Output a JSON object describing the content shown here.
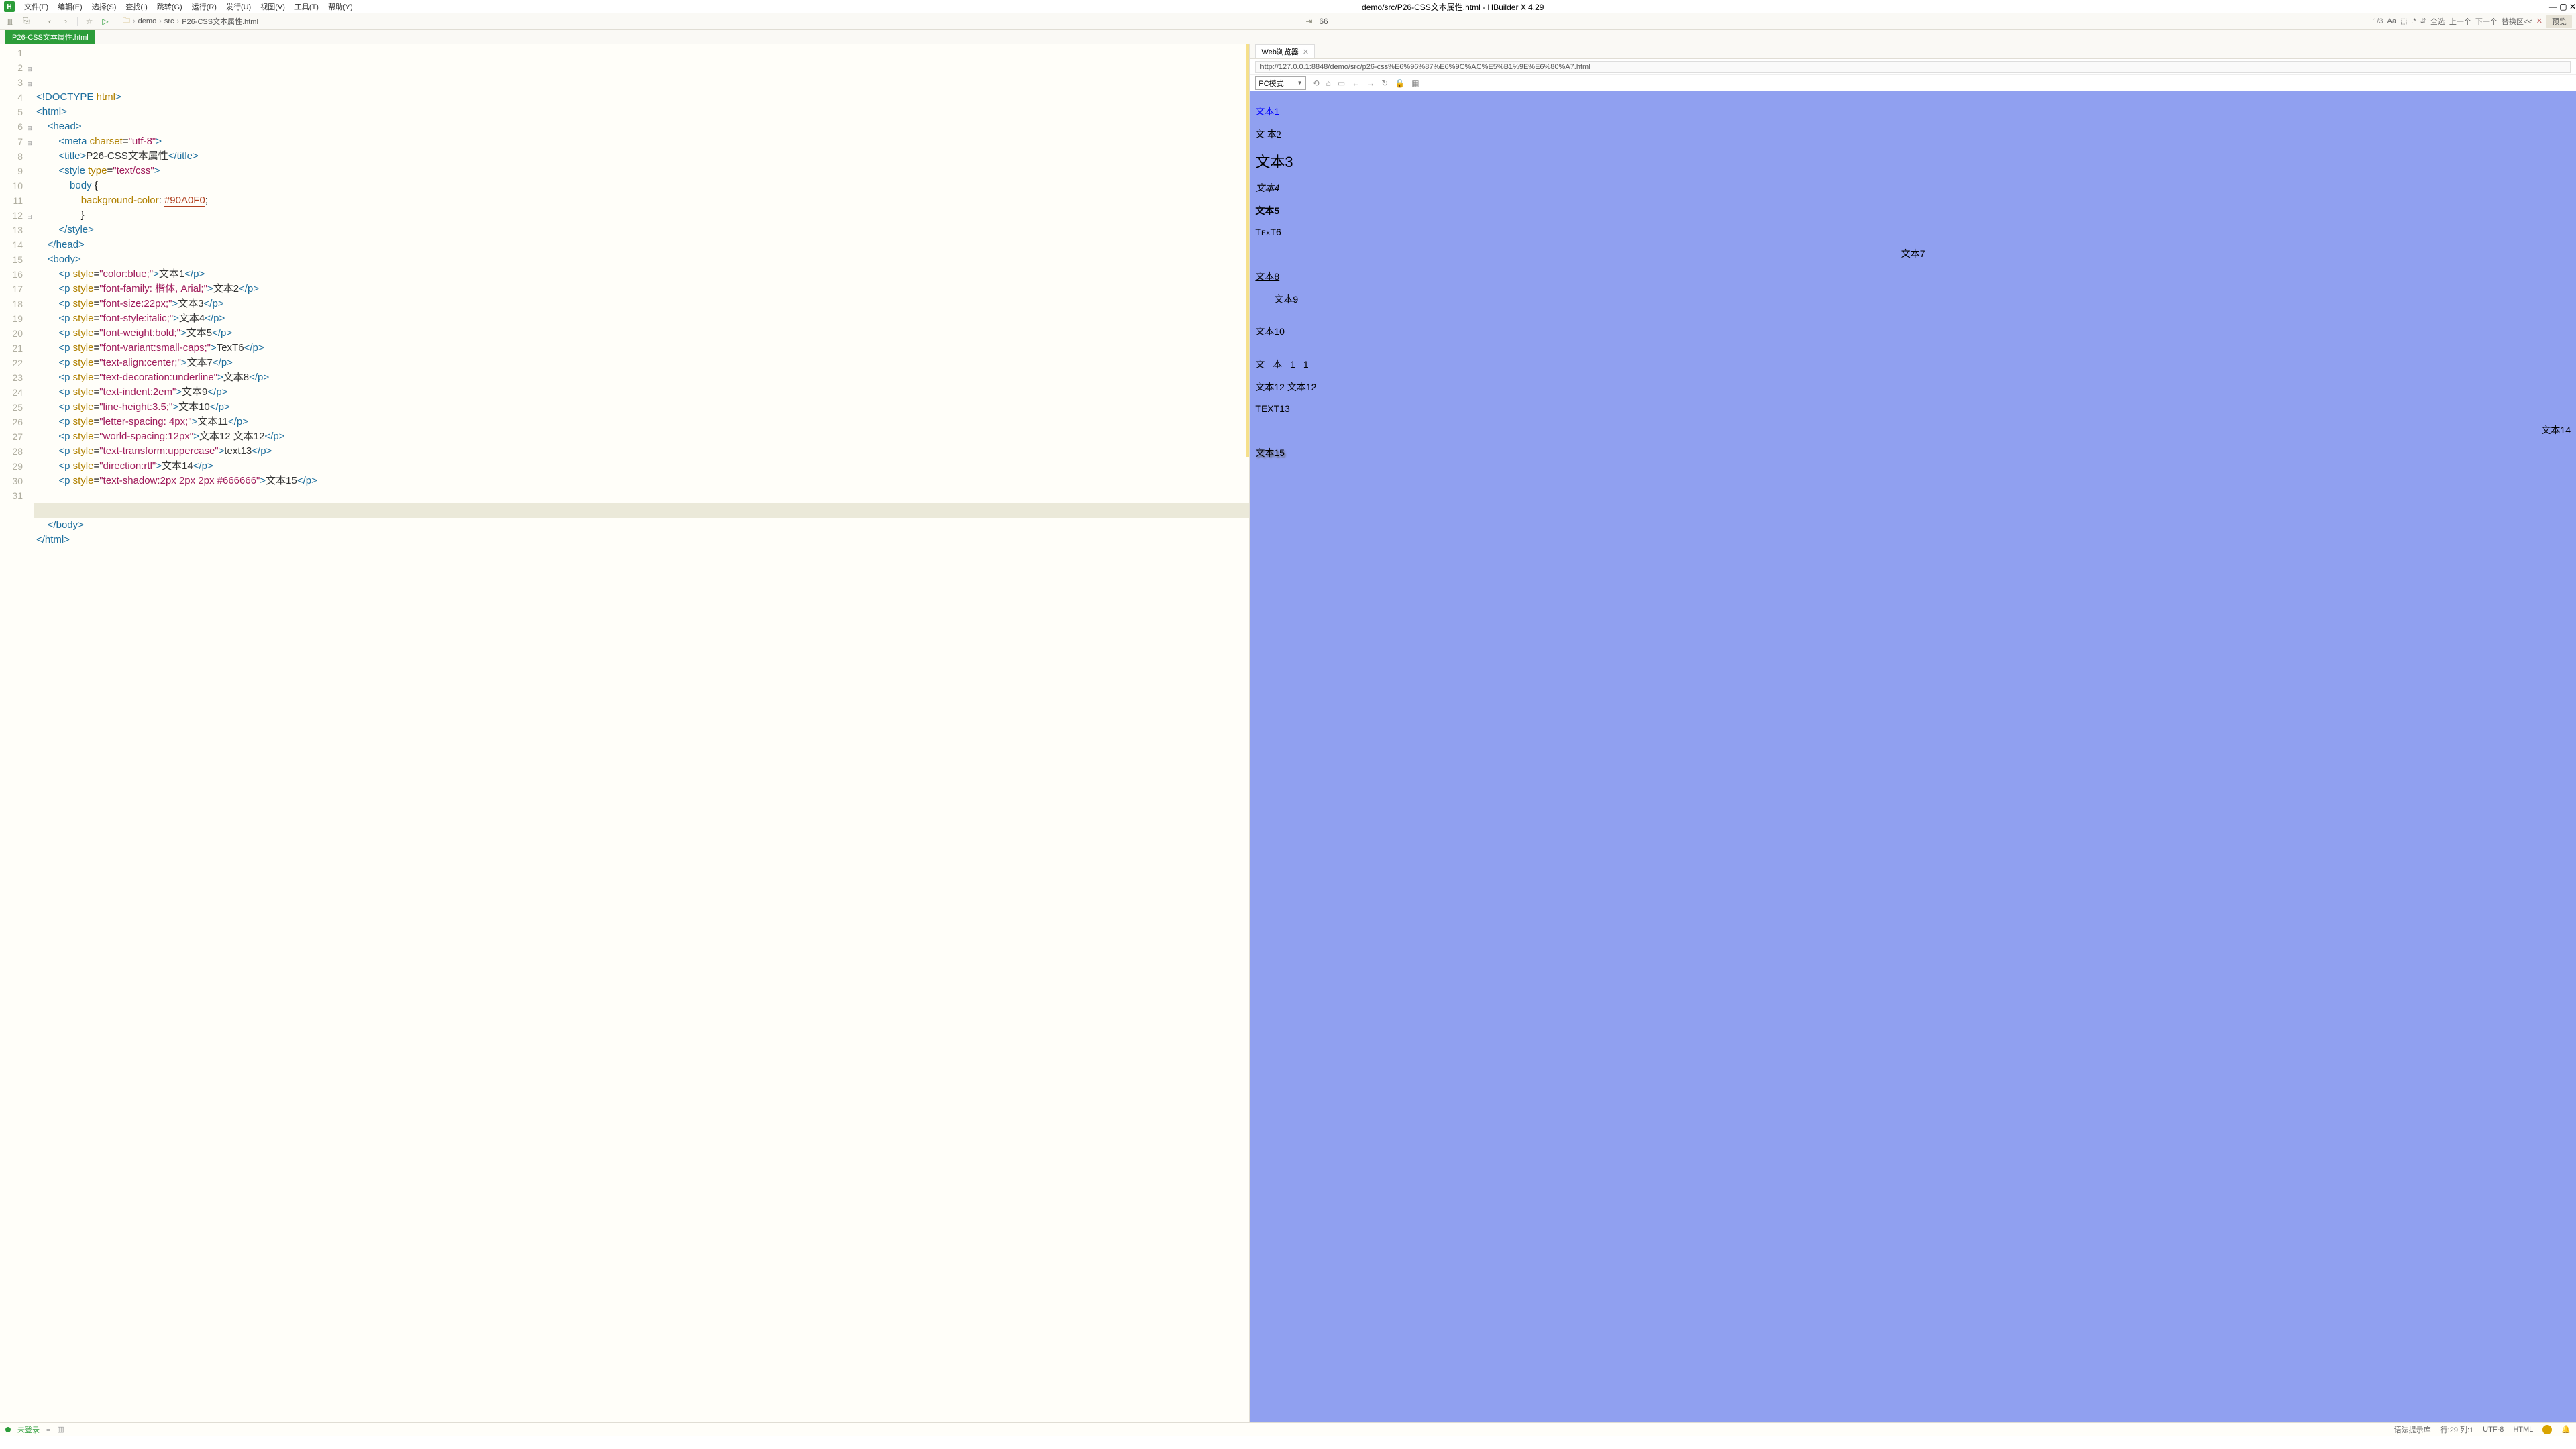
{
  "window": {
    "title": "demo/src/P26-CSS文本属性.html - HBuilder X 4.29"
  },
  "menu": {
    "items": [
      "文件(F)",
      "编辑(E)",
      "选择(S)",
      "查找(I)",
      "跳转(G)",
      "运行(R)",
      "发行(U)",
      "视图(V)",
      "工具(T)",
      "帮助(Y)"
    ]
  },
  "breadcrumb": {
    "items": [
      "demo",
      "src",
      "P26-CSS文本属性.html"
    ]
  },
  "toolbar": {
    "line_indicator": "66",
    "page_indicator": "1/3",
    "actions": [
      "Aa",
      "⬚",
      ".*",
      "⇵",
      "全选",
      "上一个",
      "下一个",
      "替换区<<"
    ],
    "preview_label": "预览"
  },
  "tabs": {
    "active": "P26-CSS文本属性.html"
  },
  "code": {
    "lines": [
      {
        "n": 1,
        "html": "<span class='doctype'>&lt;!DOCTYPE</span> <span class='attr'>html</span><span class='doctype'>&gt;</span>"
      },
      {
        "n": 2,
        "fold": "⊟",
        "html": "<span class='tag'>&lt;html&gt;</span>"
      },
      {
        "n": 3,
        "fold": "⊟",
        "html": "    <span class='tag'>&lt;head&gt;</span>"
      },
      {
        "n": 4,
        "html": "        <span class='tag'>&lt;meta</span> <span class='attr'>charset</span>=<span class='str'>\"utf-8\"</span><span class='tag'>&gt;</span>"
      },
      {
        "n": 5,
        "html": "        <span class='tag'>&lt;title&gt;</span><span class='txt'>P26-CSS文本属性</span><span class='tag'>&lt;/title&gt;</span>"
      },
      {
        "n": 6,
        "fold": "⊟",
        "html": "        <span class='tag'>&lt;style</span> <span class='attr'>type</span>=<span class='str'>\"text/css\"</span><span class='tag'>&gt;</span>"
      },
      {
        "n": 7,
        "fold": "⊟",
        "html": "            <span class='kw'>body</span> {"
      },
      {
        "n": 8,
        "html": "                <span class='attr'>background-color</span>: <span class='hex'>#90A0F0</span>;"
      },
      {
        "n": 9,
        "html": "                }"
      },
      {
        "n": 10,
        "html": "        <span class='tag'>&lt;/style&gt;</span>"
      },
      {
        "n": 11,
        "html": "    <span class='tag'>&lt;/head&gt;</span>"
      },
      {
        "n": 12,
        "fold": "⊟",
        "html": "    <span class='tag'>&lt;body&gt;</span>"
      },
      {
        "n": 13,
        "html": "        <span class='tag'>&lt;p</span> <span class='attr'>style</span>=<span class='str'>\"color:blue;\"</span><span class='tag'>&gt;</span><span class='txt'>文本1</span><span class='tag'>&lt;/p&gt;</span>"
      },
      {
        "n": 14,
        "html": "        <span class='tag'>&lt;p</span> <span class='attr'>style</span>=<span class='str'>\"font-family: 楷体, Arial;\"</span><span class='tag'>&gt;</span><span class='txt'>文本2</span><span class='tag'>&lt;/p&gt;</span>"
      },
      {
        "n": 15,
        "html": "        <span class='tag'>&lt;p</span> <span class='attr'>style</span>=<span class='str'>\"font-size:22px;\"</span><span class='tag'>&gt;</span><span class='txt'>文本3</span><span class='tag'>&lt;/p&gt;</span>"
      },
      {
        "n": 16,
        "html": "        <span class='tag'>&lt;p</span> <span class='attr'>style</span>=<span class='str'>\"font-style:italic;\"</span><span class='tag'>&gt;</span><span class='txt'>文本4</span><span class='tag'>&lt;/p&gt;</span>"
      },
      {
        "n": 17,
        "html": "        <span class='tag'>&lt;p</span> <span class='attr'>style</span>=<span class='str'>\"font-weight:bold;\"</span><span class='tag'>&gt;</span><span class='txt'>文本5</span><span class='tag'>&lt;/p&gt;</span>"
      },
      {
        "n": 18,
        "html": "        <span class='tag'>&lt;p</span> <span class='attr'>style</span>=<span class='str'>\"font-variant:small-caps;\"</span><span class='tag'>&gt;</span><span class='txt'>TexT6</span><span class='tag'>&lt;/p&gt;</span>"
      },
      {
        "n": 19,
        "html": "        <span class='tag'>&lt;p</span> <span class='attr'>style</span>=<span class='str'>\"text-align:center;\"</span><span class='tag'>&gt;</span><span class='txt'>文本7</span><span class='tag'>&lt;/p&gt;</span>"
      },
      {
        "n": 20,
        "html": "        <span class='tag'>&lt;p</span> <span class='attr'>style</span>=<span class='str'>\"text-decoration:underline\"</span><span class='tag'>&gt;</span><span class='txt'>文本8</span><span class='tag'>&lt;/p&gt;</span>"
      },
      {
        "n": 21,
        "html": "        <span class='tag'>&lt;p</span> <span class='attr'>style</span>=<span class='str'>\"text-indent:2em\"</span><span class='tag'>&gt;</span><span class='txt'>文本9</span><span class='tag'>&lt;/p&gt;</span>"
      },
      {
        "n": 22,
        "html": "        <span class='tag'>&lt;p</span> <span class='attr'>style</span>=<span class='str'>\"line-height:3.5;\"</span><span class='tag'>&gt;</span><span class='txt'>文本10</span><span class='tag'>&lt;/p&gt;</span>"
      },
      {
        "n": 23,
        "html": "        <span class='tag'>&lt;p</span> <span class='attr'>style</span>=<span class='str'>\"letter-spacing: 4px;\"</span><span class='tag'>&gt;</span><span class='txt'>文本11</span><span class='tag'>&lt;/p&gt;</span>"
      },
      {
        "n": 24,
        "html": "        <span class='tag'>&lt;p</span> <span class='attr'>style</span>=<span class='str'>\"world-spacing:12px\"</span><span class='tag'>&gt;</span><span class='txt'>文本12 文本12</span><span class='tag'>&lt;/p&gt;</span>"
      },
      {
        "n": 25,
        "html": "        <span class='tag'>&lt;p</span> <span class='attr'>style</span>=<span class='str'>\"text-transform:uppercase\"</span><span class='tag'>&gt;</span><span class='txt'>text13</span><span class='tag'>&lt;/p&gt;</span>"
      },
      {
        "n": 26,
        "html": "        <span class='tag'>&lt;p</span> <span class='attr'>style</span>=<span class='str'>\"direction:rtl\"</span><span class='tag'>&gt;</span><span class='txt'>文本14</span><span class='tag'>&lt;/p&gt;</span>"
      },
      {
        "n": 27,
        "html": "        <span class='tag'>&lt;p</span> <span class='attr'>style</span>=<span class='str'>\"text-shadow:2px 2px 2px #666666\"</span><span class='tag'>&gt;</span><span class='txt'>文本15</span><span class='tag'>&lt;/p&gt;</span>"
      },
      {
        "n": 28,
        "html": ""
      },
      {
        "n": 29,
        "highlight": true,
        "html": ""
      },
      {
        "n": 30,
        "html": "    <span class='tag'>&lt;/body&gt;</span>"
      },
      {
        "n": 31,
        "html": "<span class='tag'>&lt;/html&gt;</span>"
      }
    ]
  },
  "preview": {
    "tab_label": "Web浏览器",
    "url": "http://127.0.0.1:8848/demo/src/p26-css%E6%96%87%E6%9C%AC%E5%B1%9E%E6%80%A7.html",
    "mode": "PC模式",
    "content": {
      "p1": "文本1",
      "p2": "文 本2",
      "p3": "文本3",
      "p4": "文本4",
      "p5": "文本5",
      "p6": "TᴇxT6",
      "p7": "文本7",
      "p8": "文本8",
      "p9": "文本9",
      "p10": "文本10",
      "p11": "文 本 1 1",
      "p12": "文本12 文本12",
      "p13": "TEXT13",
      "p14": "文本14",
      "p15": "文本15"
    }
  },
  "status": {
    "login": "未登录",
    "grammar": "语法提示库",
    "cursor": "行:29  列:1",
    "encoding": "UTF-8",
    "lang": "HTML"
  }
}
